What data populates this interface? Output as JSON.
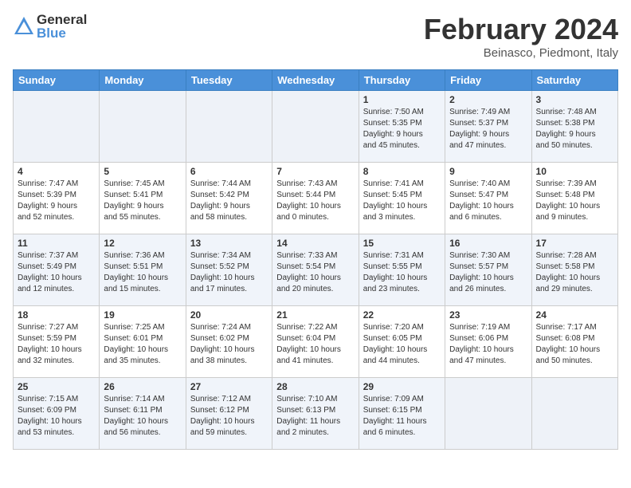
{
  "logo": {
    "general": "General",
    "blue": "Blue"
  },
  "title": "February 2024",
  "location": "Beinasco, Piedmont, Italy",
  "days_of_week": [
    "Sunday",
    "Monday",
    "Tuesday",
    "Wednesday",
    "Thursday",
    "Friday",
    "Saturday"
  ],
  "weeks": [
    {
      "days": [
        {
          "num": "",
          "info": ""
        },
        {
          "num": "",
          "info": ""
        },
        {
          "num": "",
          "info": ""
        },
        {
          "num": "",
          "info": ""
        },
        {
          "num": "1",
          "info": "Sunrise: 7:50 AM\nSunset: 5:35 PM\nDaylight: 9 hours\nand 45 minutes."
        },
        {
          "num": "2",
          "info": "Sunrise: 7:49 AM\nSunset: 5:37 PM\nDaylight: 9 hours\nand 47 minutes."
        },
        {
          "num": "3",
          "info": "Sunrise: 7:48 AM\nSunset: 5:38 PM\nDaylight: 9 hours\nand 50 minutes."
        }
      ]
    },
    {
      "days": [
        {
          "num": "4",
          "info": "Sunrise: 7:47 AM\nSunset: 5:39 PM\nDaylight: 9 hours\nand 52 minutes."
        },
        {
          "num": "5",
          "info": "Sunrise: 7:45 AM\nSunset: 5:41 PM\nDaylight: 9 hours\nand 55 minutes."
        },
        {
          "num": "6",
          "info": "Sunrise: 7:44 AM\nSunset: 5:42 PM\nDaylight: 9 hours\nand 58 minutes."
        },
        {
          "num": "7",
          "info": "Sunrise: 7:43 AM\nSunset: 5:44 PM\nDaylight: 10 hours\nand 0 minutes."
        },
        {
          "num": "8",
          "info": "Sunrise: 7:41 AM\nSunset: 5:45 PM\nDaylight: 10 hours\nand 3 minutes."
        },
        {
          "num": "9",
          "info": "Sunrise: 7:40 AM\nSunset: 5:47 PM\nDaylight: 10 hours\nand 6 minutes."
        },
        {
          "num": "10",
          "info": "Sunrise: 7:39 AM\nSunset: 5:48 PM\nDaylight: 10 hours\nand 9 minutes."
        }
      ]
    },
    {
      "days": [
        {
          "num": "11",
          "info": "Sunrise: 7:37 AM\nSunset: 5:49 PM\nDaylight: 10 hours\nand 12 minutes."
        },
        {
          "num": "12",
          "info": "Sunrise: 7:36 AM\nSunset: 5:51 PM\nDaylight: 10 hours\nand 15 minutes."
        },
        {
          "num": "13",
          "info": "Sunrise: 7:34 AM\nSunset: 5:52 PM\nDaylight: 10 hours\nand 17 minutes."
        },
        {
          "num": "14",
          "info": "Sunrise: 7:33 AM\nSunset: 5:54 PM\nDaylight: 10 hours\nand 20 minutes."
        },
        {
          "num": "15",
          "info": "Sunrise: 7:31 AM\nSunset: 5:55 PM\nDaylight: 10 hours\nand 23 minutes."
        },
        {
          "num": "16",
          "info": "Sunrise: 7:30 AM\nSunset: 5:57 PM\nDaylight: 10 hours\nand 26 minutes."
        },
        {
          "num": "17",
          "info": "Sunrise: 7:28 AM\nSunset: 5:58 PM\nDaylight: 10 hours\nand 29 minutes."
        }
      ]
    },
    {
      "days": [
        {
          "num": "18",
          "info": "Sunrise: 7:27 AM\nSunset: 5:59 PM\nDaylight: 10 hours\nand 32 minutes."
        },
        {
          "num": "19",
          "info": "Sunrise: 7:25 AM\nSunset: 6:01 PM\nDaylight: 10 hours\nand 35 minutes."
        },
        {
          "num": "20",
          "info": "Sunrise: 7:24 AM\nSunset: 6:02 PM\nDaylight: 10 hours\nand 38 minutes."
        },
        {
          "num": "21",
          "info": "Sunrise: 7:22 AM\nSunset: 6:04 PM\nDaylight: 10 hours\nand 41 minutes."
        },
        {
          "num": "22",
          "info": "Sunrise: 7:20 AM\nSunset: 6:05 PM\nDaylight: 10 hours\nand 44 minutes."
        },
        {
          "num": "23",
          "info": "Sunrise: 7:19 AM\nSunset: 6:06 PM\nDaylight: 10 hours\nand 47 minutes."
        },
        {
          "num": "24",
          "info": "Sunrise: 7:17 AM\nSunset: 6:08 PM\nDaylight: 10 hours\nand 50 minutes."
        }
      ]
    },
    {
      "days": [
        {
          "num": "25",
          "info": "Sunrise: 7:15 AM\nSunset: 6:09 PM\nDaylight: 10 hours\nand 53 minutes."
        },
        {
          "num": "26",
          "info": "Sunrise: 7:14 AM\nSunset: 6:11 PM\nDaylight: 10 hours\nand 56 minutes."
        },
        {
          "num": "27",
          "info": "Sunrise: 7:12 AM\nSunset: 6:12 PM\nDaylight: 10 hours\nand 59 minutes."
        },
        {
          "num": "28",
          "info": "Sunrise: 7:10 AM\nSunset: 6:13 PM\nDaylight: 11 hours\nand 2 minutes."
        },
        {
          "num": "29",
          "info": "Sunrise: 7:09 AM\nSunset: 6:15 PM\nDaylight: 11 hours\nand 6 minutes."
        },
        {
          "num": "",
          "info": ""
        },
        {
          "num": "",
          "info": ""
        }
      ]
    }
  ]
}
